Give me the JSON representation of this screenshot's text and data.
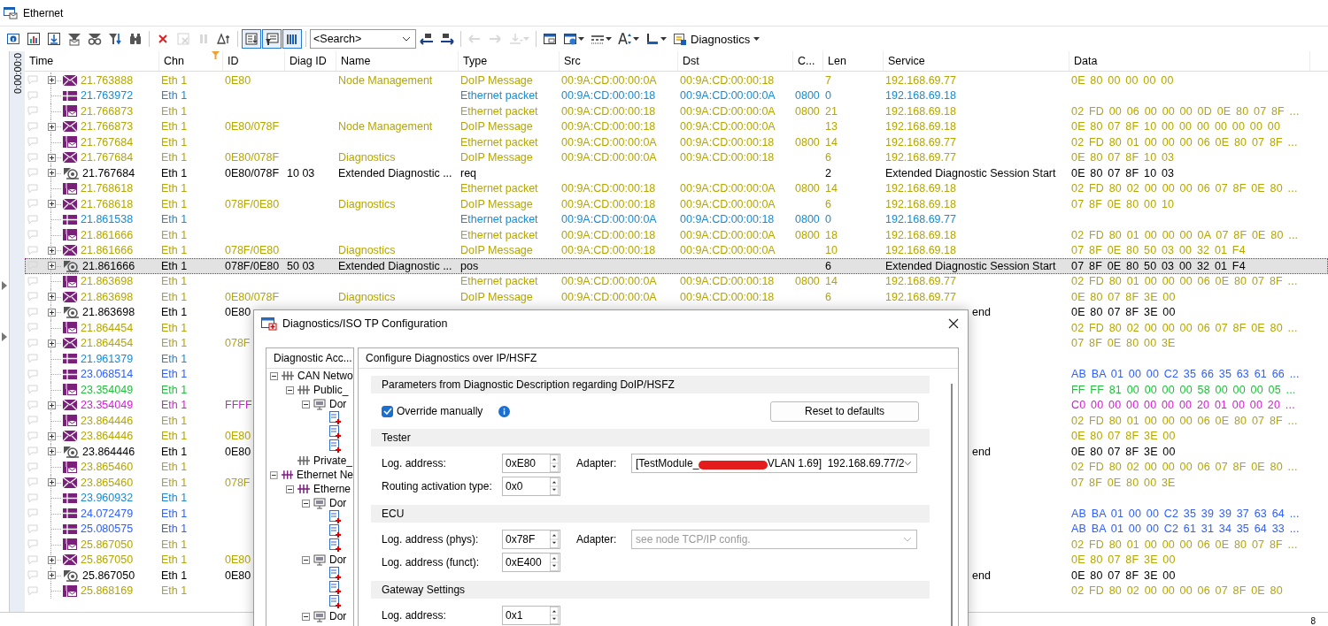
{
  "window": {
    "title": "Ethernet"
  },
  "toolbar": {
    "buttons": [
      {
        "kind": "info",
        "on": false,
        "disabled": false
      },
      {
        "kind": "chart",
        "on": false,
        "disabled": false
      },
      {
        "kind": "import",
        "on": false,
        "disabled": false
      },
      {
        "kind": "mailfilter",
        "on": false,
        "disabled": false
      },
      {
        "kind": "glasses",
        "on": false,
        "disabled": false
      },
      {
        "kind": "sortfilter",
        "on": false,
        "disabled": false
      },
      {
        "kind": "binoculars",
        "on": false,
        "disabled": false
      },
      {
        "kind": "delete",
        "on": false,
        "disabled": false
      },
      {
        "kind": "clear",
        "on": false,
        "disabled": true
      },
      {
        "kind": "pause",
        "on": false,
        "disabled": true
      },
      {
        "kind": "delta",
        "on": false,
        "disabled": false
      },
      {
        "kind": "scroll",
        "on": true,
        "disabled": false
      },
      {
        "kind": "listfilter",
        "on": true,
        "disabled": false
      },
      {
        "kind": "columns",
        "on": true,
        "disabled": false
      }
    ],
    "search": {
      "placeholder": "<Search>"
    },
    "buttons_after": [
      {
        "kind": "findprev",
        "on": false,
        "disabled": false
      },
      {
        "kind": "findnext",
        "on": false,
        "disabled": false
      },
      {
        "kind": "left",
        "on": false,
        "disabled": true
      },
      {
        "kind": "right",
        "on": false,
        "disabled": true
      },
      {
        "kind": "insert",
        "on": false,
        "disabled": true
      },
      {
        "kind": "window",
        "on": false,
        "disabled": false
      },
      {
        "kind": "windowmenu",
        "on": false,
        "disabled": false
      },
      {
        "kind": "linestyle",
        "on": false,
        "disabled": false
      },
      {
        "kind": "fontsize",
        "on": false,
        "disabled": false
      },
      {
        "kind": "colorbar",
        "on": false,
        "disabled": false
      }
    ],
    "menu_label": "Diagnostics"
  },
  "time_marker": "0:00:00:0",
  "table": {
    "columns": [
      {
        "label": "Time"
      },
      {
        "label": "Chn",
        "filtered": true
      },
      {
        "label": "ID"
      },
      {
        "label": "Diag ID"
      },
      {
        "label": "Name"
      },
      {
        "label": "Type"
      },
      {
        "label": "Src"
      },
      {
        "label": "Dst"
      },
      {
        "label": "C..."
      },
      {
        "label": "Len"
      },
      {
        "label": "Service"
      },
      {
        "label": "Data"
      }
    ],
    "rows": [
      {
        "kind": "doip",
        "expanded": false,
        "selected": false,
        "color": "#b5a600",
        "time": "21.763888",
        "chn": "Eth 1",
        "id": "0E80",
        "name": "Node Management",
        "type": "DoIP Message",
        "src": "00:9A:CD:00:00:0A",
        "dst": "00:9A:CD:00:00:18",
        "len": "7",
        "service": "192.168.69.77",
        "data": "0E 80 00 00 00 00"
      },
      {
        "kind": "eth",
        "selected": false,
        "color": "#1a8ad4",
        "time": "21.763972",
        "chn": "Eth 1",
        "type": "Ethernet packet",
        "src": "00:9A:CD:00:00:18",
        "dst": "00:9A:CD:00:00:0A",
        "c": "0800",
        "len": "0",
        "service": "192.168.69.18"
      },
      {
        "kind": "ethdoip",
        "selected": false,
        "color": "#b5a600",
        "time": "21.766873",
        "chn": "Eth 1",
        "type": "Ethernet packet",
        "src": "00:9A:CD:00:00:18",
        "dst": "00:9A:CD:00:00:0A",
        "c": "0800",
        "len": "21",
        "service": "192.168.69.18",
        "data": "02 FD 00 06 00 00 00 0D 0E 80 07 8F  ..."
      },
      {
        "kind": "doip",
        "expanded": false,
        "selected": false,
        "color": "#b5a600",
        "time": "21.766873",
        "chn": "Eth 1",
        "id": "0E80/078F",
        "name": "Node Management",
        "type": "DoIP Message",
        "src": "00:9A:CD:00:00:18",
        "dst": "00:9A:CD:00:00:0A",
        "len": "13",
        "service": "192.168.69.18",
        "data": "0E 80 07 8F 10 00 00 00 00 00 00 00"
      },
      {
        "kind": "ethdoip",
        "selected": false,
        "color": "#b5a600",
        "time": "21.767684",
        "chn": "Eth 1",
        "type": "Ethernet packet",
        "src": "00:9A:CD:00:00:0A",
        "dst": "00:9A:CD:00:00:18",
        "c": "0800",
        "len": "14",
        "service": "192.168.69.77",
        "data": "02 FD 80 01 00 00 00 06 0E 80 07 8F  ..."
      },
      {
        "kind": "doip",
        "expanded": false,
        "selected": false,
        "color": "#b5a600",
        "time": "21.767684",
        "chn": "Eth 1",
        "id": "0E80/078F",
        "name": "Diagnostics",
        "type": "DoIP Message",
        "src": "00:9A:CD:00:00:0A",
        "dst": "00:9A:CD:00:00:18",
        "len": "6",
        "service": "192.168.69.77",
        "data": "0E 80 07 8F 10 03"
      },
      {
        "kind": "diag",
        "expanded": false,
        "selected": false,
        "color": "#000000",
        "time": "21.767684",
        "chn": "Eth 1",
        "id": "0E80/078F",
        "diag_id": "10 03",
        "name": "Extended Diagnostic ...",
        "type": "req",
        "len": "2",
        "service": "Extended Diagnostic Session Start",
        "data": "0E 80 07 8F 10 03"
      },
      {
        "kind": "ethdoip",
        "selected": false,
        "color": "#b5a600",
        "time": "21.768618",
        "chn": "Eth 1",
        "type": "Ethernet packet",
        "src": "00:9A:CD:00:00:18",
        "dst": "00:9A:CD:00:00:0A",
        "c": "0800",
        "len": "14",
        "service": "192.168.69.18",
        "data": "02 FD 80 02 00 00 00 06 07 8F 0E 80  ..."
      },
      {
        "kind": "doip",
        "expanded": false,
        "selected": false,
        "color": "#b5a600",
        "time": "21.768618",
        "chn": "Eth 1",
        "id": "078F/0E80",
        "name": "Diagnostics",
        "type": "DoIP Message",
        "src": "00:9A:CD:00:00:18",
        "dst": "00:9A:CD:00:00:0A",
        "len": "6",
        "service": "192.168.69.18",
        "data": "07 8F 0E 80 00 10"
      },
      {
        "kind": "eth",
        "selected": false,
        "color": "#1a8ad4",
        "time": "21.861538",
        "chn": "Eth 1",
        "type": "Ethernet packet",
        "src": "00:9A:CD:00:00:0A",
        "dst": "00:9A:CD:00:00:18",
        "c": "0800",
        "len": "0",
        "service": "192.168.69.77"
      },
      {
        "kind": "ethdoip",
        "selected": false,
        "color": "#b5a600",
        "time": "21.861666",
        "chn": "Eth 1",
        "type": "Ethernet packet",
        "src": "00:9A:CD:00:00:18",
        "dst": "00:9A:CD:00:00:0A",
        "c": "0800",
        "len": "18",
        "service": "192.168.69.18",
        "data": "02 FD 80 01 00 00 00 0A 07 8F 0E 80  ..."
      },
      {
        "kind": "doip",
        "expanded": false,
        "selected": false,
        "color": "#b5a600",
        "time": "21.861666",
        "chn": "Eth 1",
        "id": "078F/0E80",
        "name": "Diagnostics",
        "type": "DoIP Message",
        "src": "00:9A:CD:00:00:18",
        "dst": "00:9A:CD:00:00:0A",
        "len": "10",
        "service": "192.168.69.18",
        "data": "07 8F 0E 80 50 03 00 32 01 F4"
      },
      {
        "kind": "diag",
        "expanded": false,
        "selected": true,
        "color": "#000000",
        "time": "21.861666",
        "chn": "Eth 1",
        "id": "078F/0E80",
        "diag_id": "50 03",
        "name": "Extended Diagnostic ...",
        "type": "pos",
        "len": "6",
        "service": "Extended Diagnostic Session Start",
        "data": "07 8F 0E 80 50 03 00 32 01 F4"
      },
      {
        "kind": "ethdoip",
        "selected": false,
        "color": "#b5a600",
        "time": "21.863698",
        "chn": "Eth 1",
        "type": "Ethernet packet",
        "src": "00:9A:CD:00:00:0A",
        "dst": "00:9A:CD:00:00:18",
        "c": "0800",
        "len": "14",
        "service": "192.168.69.77",
        "data": "02 FD 80 01 00 00 00 06 0E 80 07 8F  ..."
      },
      {
        "kind": "doip",
        "expanded": false,
        "selected": false,
        "color": "#b5a600",
        "time": "21.863698",
        "chn": "Eth 1",
        "id": "0E80/078F",
        "name": "Diagnostics",
        "type": "DoIP Message",
        "src": "00:9A:CD:00:00:0A",
        "dst": "00:9A:CD:00:00:18",
        "len": "6",
        "service": "192.168.69.77",
        "data": "0E 80 07 8F 3E 00"
      },
      {
        "kind": "diag",
        "expanded": false,
        "selected": false,
        "color": "#000000",
        "time": "21.863698",
        "chn": "Eth 1",
        "id": "0E80",
        "service": "end",
        "data": "0E 80 07 8F 3E 00"
      },
      {
        "kind": "ethdoip",
        "selected": false,
        "color": "#b5a600",
        "time": "21.864454",
        "chn": "Eth 1",
        "data": "02 FD 80 02 00 00 00 06 07 8F 0E 80  ..."
      },
      {
        "kind": "doip",
        "expanded": false,
        "selected": false,
        "color": "#b5a600",
        "time": "21.864454",
        "chn": "Eth 1",
        "id": "078F",
        "data": "07 8F 0E 80 00 3E"
      },
      {
        "kind": "eth",
        "selected": false,
        "color": "#1a8ad4",
        "time": "21.961379",
        "chn": "Eth 1"
      },
      {
        "kind": "eth",
        "selected": false,
        "color": "#2f5eff",
        "time": "23.068514",
        "chn": "Eth 1",
        "data": "AB BA 01 00 00 C2 35 66 35 63 61 66  ..."
      },
      {
        "kind": "ethdoip",
        "selected": false,
        "color": "#1fbf3a",
        "time": "23.354049",
        "chn": "Eth 1",
        "data": "FF FF 81 00 00 00 00 58 00 00 00 05  ..."
      },
      {
        "kind": "doip",
        "expanded": false,
        "selected": false,
        "color": "#d61ad6",
        "time": "23.354049",
        "chn": "Eth 1",
        "id": "FFFF",
        "data": "C0 00 00 00 00 00 00 20 01 00 00 20  ..."
      },
      {
        "kind": "ethdoip",
        "selected": false,
        "color": "#b5a600",
        "time": "23.864446",
        "chn": "Eth 1",
        "data": "02 FD 80 01 00 00 00 06 0E 80 07 8F  ..."
      },
      {
        "kind": "doip",
        "expanded": false,
        "selected": false,
        "color": "#b5a600",
        "time": "23.864446",
        "chn": "Eth 1",
        "id": "0E80",
        "data": "0E 80 07 8F 3E 00"
      },
      {
        "kind": "diag",
        "expanded": false,
        "selected": false,
        "color": "#000000",
        "time": "23.864446",
        "chn": "Eth 1",
        "id": "0E80",
        "service": "end",
        "data": "0E 80 07 8F 3E 00"
      },
      {
        "kind": "ethdoip",
        "selected": false,
        "color": "#b5a600",
        "time": "23.865460",
        "chn": "Eth 1",
        "data": "02 FD 80 02 00 00 00 06 07 8F 0E 80  ..."
      },
      {
        "kind": "doip",
        "expanded": false,
        "selected": false,
        "color": "#b5a600",
        "time": "23.865460",
        "chn": "Eth 1",
        "id": "078F",
        "data": "07 8F 0E 80 00 3E"
      },
      {
        "kind": "eth",
        "selected": false,
        "color": "#1a8ad4",
        "time": "23.960932",
        "chn": "Eth 1"
      },
      {
        "kind": "eth",
        "selected": false,
        "color": "#2f5eff",
        "time": "24.072479",
        "chn": "Eth 1",
        "data": "AB BA 01 00 00 C2 35 39 39 37 63 64  ..."
      },
      {
        "kind": "eth",
        "selected": false,
        "color": "#2f5eff",
        "time": "25.080575",
        "chn": "Eth 1",
        "data": "AB BA 01 00 00 C2 61 31 34 35 64 33  ..."
      },
      {
        "kind": "ethdoip",
        "selected": false,
        "color": "#b5a600",
        "time": "25.867050",
        "chn": "Eth 1",
        "data": "02 FD 80 01 00 00 00 06 0E 80 07 8F  ..."
      },
      {
        "kind": "doip",
        "expanded": false,
        "selected": false,
        "color": "#b5a600",
        "time": "25.867050",
        "chn": "Eth 1",
        "id": "0E80",
        "data": "0E 80 07 8F 3E 00"
      },
      {
        "kind": "diag",
        "expanded": false,
        "selected": false,
        "color": "#000000",
        "time": "25.867050",
        "chn": "Eth 1",
        "id": "0E80",
        "service": "end",
        "data": "0E 80 07 8F 3E 00"
      },
      {
        "kind": "ethdoip",
        "selected": false,
        "color": "#b5a600",
        "time": "25.868169",
        "chn": "Eth 1",
        "data": "02 FD 80 02 00 00 00 06 07 8F 0E 80"
      }
    ]
  },
  "status_bar": {
    "value": "8"
  },
  "dialog": {
    "title": "Diagnostics/ISO TP Configuration",
    "tree_header": "Diagnostic Acc...",
    "tree": [
      {
        "kind": "can",
        "label": "CAN Netwo",
        "expanded": true,
        "children": [
          {
            "kind": "can",
            "label": "Public_",
            "expanded": true,
            "children": [
              {
                "kind": "node",
                "label": "Dor",
                "expanded": true,
                "children": [
                  {
                    "kind": "doc"
                  },
                  {
                    "kind": "doc"
                  },
                  {
                    "kind": "doc"
                  }
                ]
              }
            ]
          },
          {
            "kind": "can",
            "label": "Private_"
          }
        ]
      },
      {
        "kind": "eth",
        "label": "Ethernet Ne",
        "expanded": true,
        "children": [
          {
            "kind": "eth",
            "label": "Etherne",
            "expanded": true,
            "children": [
              {
                "kind": "node",
                "label": "Dor",
                "expanded": true,
                "children": [
                  {
                    "kind": "doc"
                  },
                  {
                    "kind": "doc"
                  },
                  {
                    "kind": "doc"
                  }
                ]
              },
              {
                "kind": "node",
                "label": "Dor",
                "expanded": true,
                "children": [
                  {
                    "kind": "doc"
                  },
                  {
                    "kind": "doc"
                  },
                  {
                    "kind": "doc"
                  }
                ]
              },
              {
                "kind": "node",
                "label": "Dor",
                "expanded": true
              }
            ]
          }
        ]
      }
    ],
    "panel_header": "Configure Diagnostics over IP/HSFZ",
    "parameters": {
      "title": "Parameters from Diagnostic Description regarding DoIP/HSFZ",
      "checkbox": {
        "label": "Override manually",
        "checked": true
      },
      "button": "Reset to defaults"
    },
    "sections": [
      {
        "title": "Tester",
        "fields": [
          {
            "label": "Log. address:",
            "value": "0xE80",
            "adapter": {
              "label": "Adapter:",
              "value_parts": [
                "[TestModule_",
                "VLAN 1.69]  192.168.69.77/2"
              ],
              "disabled": false
            }
          },
          {
            "label": "Routing activation type:",
            "value": "0x0"
          }
        ]
      },
      {
        "title": "ECU",
        "fields": [
          {
            "label": "Log. address (phys):",
            "value": "0x78F",
            "adapter": {
              "label": "Adapter:",
              "value_parts": [
                "see node TCP/IP config."
              ],
              "disabled": true
            }
          },
          {
            "label": "Log. address (funct):",
            "value": "0xE400"
          }
        ]
      },
      {
        "title": "Gateway Settings",
        "fields": [
          {
            "label": "Log. address:",
            "value": "0x1"
          }
        ]
      }
    ]
  }
}
